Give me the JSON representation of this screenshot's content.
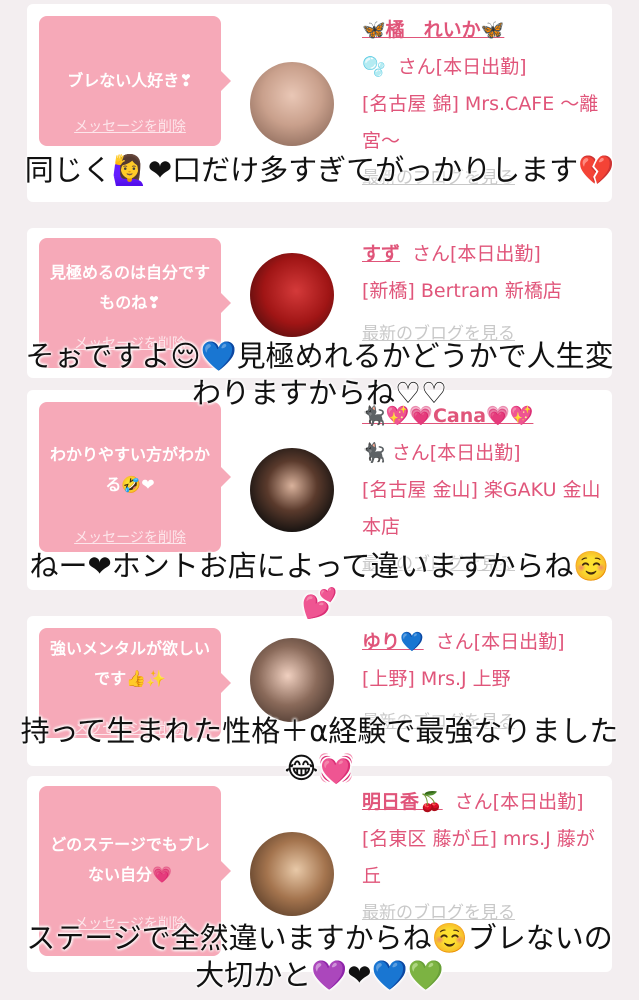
{
  "cards": [
    {
      "message": "ブレない人好き❣",
      "delete_label": "メッセージを削除",
      "name": "🦋橘　れいか🦋",
      "prefix_icon": "🫧",
      "san_status": "さん[本日出勤]",
      "shop": "[名古屋 錦] Mrs.CAFE ～離宮～",
      "blog": "最新のブログを見る",
      "caption": "同じく🙋‍♀️❤口だけ多すぎてがっかりします💔"
    },
    {
      "message": "見極めるのは自分ですものね❣",
      "delete_label": "メッセージを削除",
      "name": "すず",
      "san_status": "さん[本日出勤]",
      "shop": "[新橋] Bertram 新橋店",
      "blog": "最新のブログを見る",
      "caption": "そぉですよ😌💙見極めれるかどうかで人生変わりますからね♡♡"
    },
    {
      "message": "わかりやすい方がわかる🤣❤",
      "delete_label": "メッセージを削除",
      "name": "🐈‍⬛💖💗Cana💗💖",
      "san_status": "🐈‍⬛ さん[本日出勤]",
      "shop": "[名古屋 金山] 楽GAKU 金山本店",
      "blog": "最新のブログを見る",
      "caption": "ねー❤ホントお店によって違いますからね☺️💕"
    },
    {
      "message": "強いメンタルが欲しいです👍✨",
      "delete_label": "メッセージを削除",
      "name": "ゆり💙",
      "san_status": "さん[本日出勤]",
      "shop": "[上野] Mrs.J 上野",
      "blog": "最新のブログを見る",
      "caption": "持って生まれた性格＋α経験で最強なりました😂💓"
    },
    {
      "message": "どのステージでもブレない自分💗",
      "delete_label": "メッセージを削除",
      "name": "明日香🍒",
      "san_status": "さん[本日出勤]",
      "shop": "[名東区 藤が丘] mrs.J 藤が丘",
      "blog": "最新のブログを見る",
      "caption": "ステージで全然違いますからね☺️ブレないの大切かと💜❤💙💚"
    }
  ]
}
